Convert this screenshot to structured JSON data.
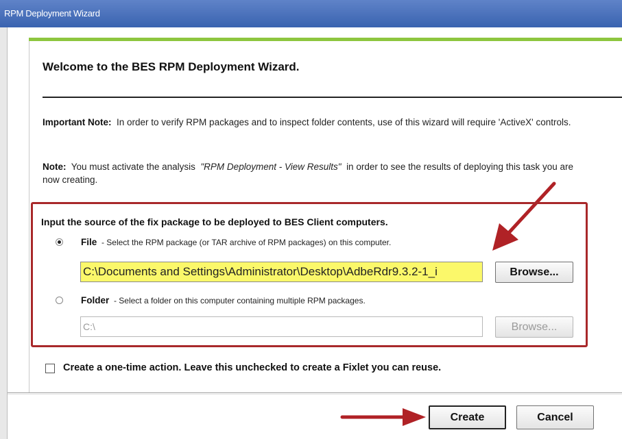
{
  "window": {
    "title": "RPM Deployment Wizard"
  },
  "heading": "Welcome to the BES RPM Deployment Wizard.",
  "important_note": {
    "label": "Important Note:",
    "text": "In order to verify RPM packages and to inspect folder contents, use of this wizard will require 'ActiveX' controls."
  },
  "note": {
    "label": "Note:",
    "text_before": "You must activate the analysis",
    "analysis_name": "\"RPM Deployment - View Results\"",
    "text_after": "in order to see the results of deploying this task you are now creating."
  },
  "source_section": {
    "title": "Input the source of the fix package to be deployed to BES Client computers.",
    "file_option": {
      "label": "File",
      "description": "- Select the RPM package (or TAR archive of RPM packages) on this computer.",
      "selected": true,
      "value": "C:\\Documents and Settings\\Administrator\\Desktop\\AdbeRdr9.3.2-1_i",
      "browse_label": "Browse..."
    },
    "folder_option": {
      "label": "Folder",
      "description": "- Select a folder on this computer containing multiple RPM packages.",
      "selected": false,
      "value": "C:\\",
      "browse_label": "Browse..."
    }
  },
  "one_time_action": {
    "label": "Create a one-time action. Leave this unchecked to create a Fixlet you can reuse.",
    "checked": false
  },
  "buttons": {
    "create": "Create",
    "cancel": "Cancel"
  },
  "colors": {
    "accent_green": "#8dc63f",
    "highlight_red": "#a8282a",
    "input_highlight": "#fbf86a"
  }
}
